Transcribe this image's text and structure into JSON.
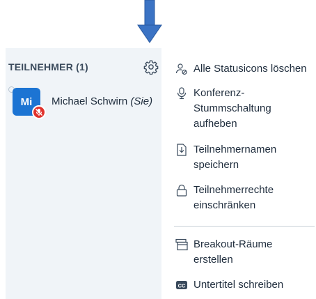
{
  "panel": {
    "header": "TEILNEHMER (1)",
    "settings_icon": "gear-icon"
  },
  "user": {
    "initials": "Mi",
    "name": "Michael Schwirn",
    "suffix": "(Sie)",
    "status_icon": "muted-microphone-icon"
  },
  "menu": {
    "items": [
      {
        "label": "Alle Statusicons löschen",
        "icon": "clear-status-icon"
      },
      {
        "label": "Konferenz-\nStummschaltung\naufheben",
        "icon": "microphone-icon"
      },
      {
        "label": "Teilnehmernamen\nspeichern",
        "icon": "download-file-icon"
      },
      {
        "label": "Teilnehmerrechte\neinschränken",
        "icon": "lock-icon"
      },
      {
        "label": "Breakout-Räume\nerstellen",
        "icon": "breakout-rooms-icon"
      },
      {
        "label": "Untertitel schreiben",
        "icon": "closed-captions-icon"
      }
    ]
  },
  "colors": {
    "accent": "#1c74d3",
    "arrow": "#3b73c4",
    "muted_badge": "#e0322d",
    "panel_bg": "#f0f4f8"
  }
}
